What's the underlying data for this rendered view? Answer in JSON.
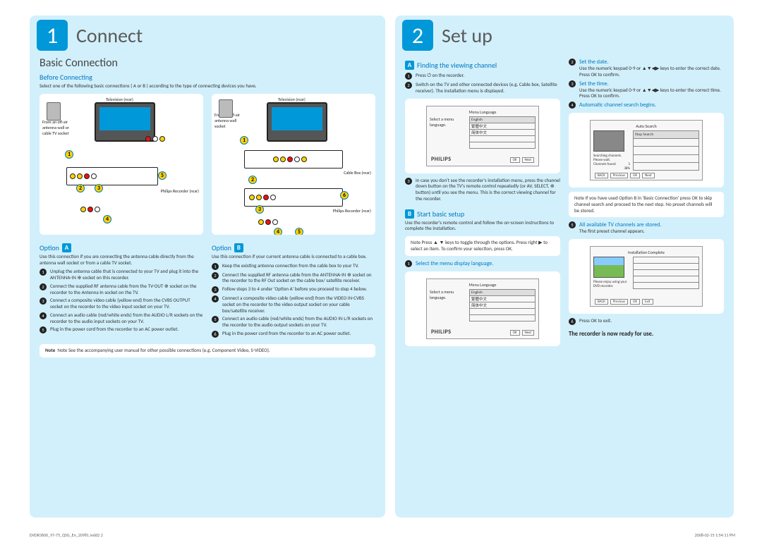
{
  "connect": {
    "badge": "1",
    "title": "Connect",
    "sectionTitle": "Basic Connection",
    "beforeTitle": "Before Connecting",
    "beforeText": "Select one of the following basic connections ( A or B ) according to the type of connecting devices you have.",
    "diagramA": {
      "tvLabel": "Television (rear)",
      "wallLabel": "From an off-air antenna wall or cable TV socket",
      "recLabel": "Philips Recorder (rear)"
    },
    "diagramB": {
      "tvLabel": "Television (rear)",
      "wallLabel": "From an off-air antenna wall socket",
      "cableLabel": "Cable Box (rear)",
      "recLabel": "Philips Recorder (rear)"
    },
    "optionA": {
      "label": "Option",
      "letter": "A",
      "intro": "Use this connection if you are connecting the antenna cable directly from the antenna wall socket or from a cable TV socket.",
      "steps": [
        "Unplug the antenna cable that is connected to your TV and plug it into the ANTENNA-IN ⊕ socket on this recorder.",
        "Connect the supplied RF antenna cable from the TV-OUT ⊕ socket on the recorder to the Antenna In socket on the TV.",
        "Connect a composite video cable (yellow end) from the CVBS OUTPUT socket on the recorder to the video input socket on your TV.",
        "Connect an audio cable (red/white ends) from the AUDIO L/R sockets on the recorder to the audio input sockets on your TV.",
        "Plug in the power cord from the recorder to an AC power outlet."
      ]
    },
    "optionB": {
      "label": "Option",
      "letter": "B",
      "intro": "Use this connection if your current antenna cable is connected to a cable box.",
      "steps": [
        "Keep the existing antenna connection from the cable box to your TV.",
        "Connect the supplied RF antenna cable from the ANTENNA-IN ⊕ socket on the recorder to the RF Out socket on the cable box/ satellite receiver.",
        "Follow steps 3 to 4 under 'Option A' before you proceed to step 4 below.",
        "Connect a composite video cable (yellow end) from the VIDEO IN-CVBS socket on the recorder to the video output socket on your cable box/satellite receiver.",
        "Connect an audio cable (red/white ends) from the AUDIO IN L/R sockets on the recorder to the audio output sockets on your TV.",
        "Plug in the power cord from the recorder to an AC power outlet."
      ]
    },
    "bottomNote": "Note   See the accompanying user manual for other possible connections (e.g. Component Video, S-VIDEO)."
  },
  "setup": {
    "badge": "2",
    "title": "Set up",
    "secA": {
      "letter": "A",
      "title": "Finding the viewing channel",
      "steps": [
        "Press ⏻ on the recorder.",
        "Switch on the TV and other connected devices (e.g. Cable box, Satellite receiver). The installation menu is displayed.",
        "In case you don't see the recorder's installation menu, press the channel down button on the TV's remote control repeatedly (or AV, SELECT, ⊕ button) until you see the menu.  This is the correct viewing channel for the recorder."
      ],
      "screen": {
        "title": "Menu Language",
        "leftText": "Select a menu language.",
        "rows": [
          "English",
          "繁體中文",
          "简体中文"
        ],
        "brand": "PHILIPS",
        "btn1": "OK",
        "btn2": "Next"
      }
    },
    "secB": {
      "letter": "B",
      "title": "Start basic setup",
      "intro": "Use the recorder's remote control and follow the on-screen instructions to complete the installation.",
      "noteBox": "Note  Press ▲ ▼ keys to toggle through the options. Press right ▶ to select an item. To confirm your selection, press OK.",
      "step1Label": "Select the menu display language.",
      "screen": {
        "title": "Menu Language",
        "leftText": "Select a menu language.",
        "rows": [
          "English",
          "繁體中文",
          "简体中文"
        ],
        "brand": "PHILIPS",
        "btn1": "OK",
        "btn2": "Next"
      },
      "step2Label": "Set the date.",
      "step2Text": "Use the numeric keypad 0-9 or ▲▼◀▶ keys to enter the correct date. Press OK to confirm.",
      "step3Label": "Set the time.",
      "step3Text": "Use the numeric keypad 0-9 or ▲▼◀▶ keys to enter the correct time. Press OK to confirm.",
      "step4Label": "Automatic channel search begins.",
      "autoScreen": {
        "title": "Auto Search",
        "row1": "Stop Search",
        "leftLine1": "Searching channels. Please wait.",
        "leftLine2": "Channels found",
        "pct": "38%",
        "count": "5",
        "btns": [
          "BACK",
          "Previous",
          "OK",
          "Next"
        ]
      },
      "noteBox2": "Note  If you have used Option B in 'Basic Connection' press OK to skip channel search and proceed to the next step. No preset channels will be stored.",
      "step5Label": "All available TV channels are stored.",
      "step5Text": "The first preset channel appears.",
      "installScreen": {
        "title": "Installation Complete",
        "leftLine": "Please enjoy using your DVD recorder.",
        "btns": [
          "BACK",
          "Previous",
          "OK",
          "Exit"
        ]
      },
      "step6Text": "Press OK to exit.",
      "ready": "The recorder is now ready for use."
    }
  },
  "footer": {
    "left": "DVDR3600_97-75_QSG_En_20981.indd2   2",
    "right": "2008-02-15   1:54:11 PM"
  }
}
